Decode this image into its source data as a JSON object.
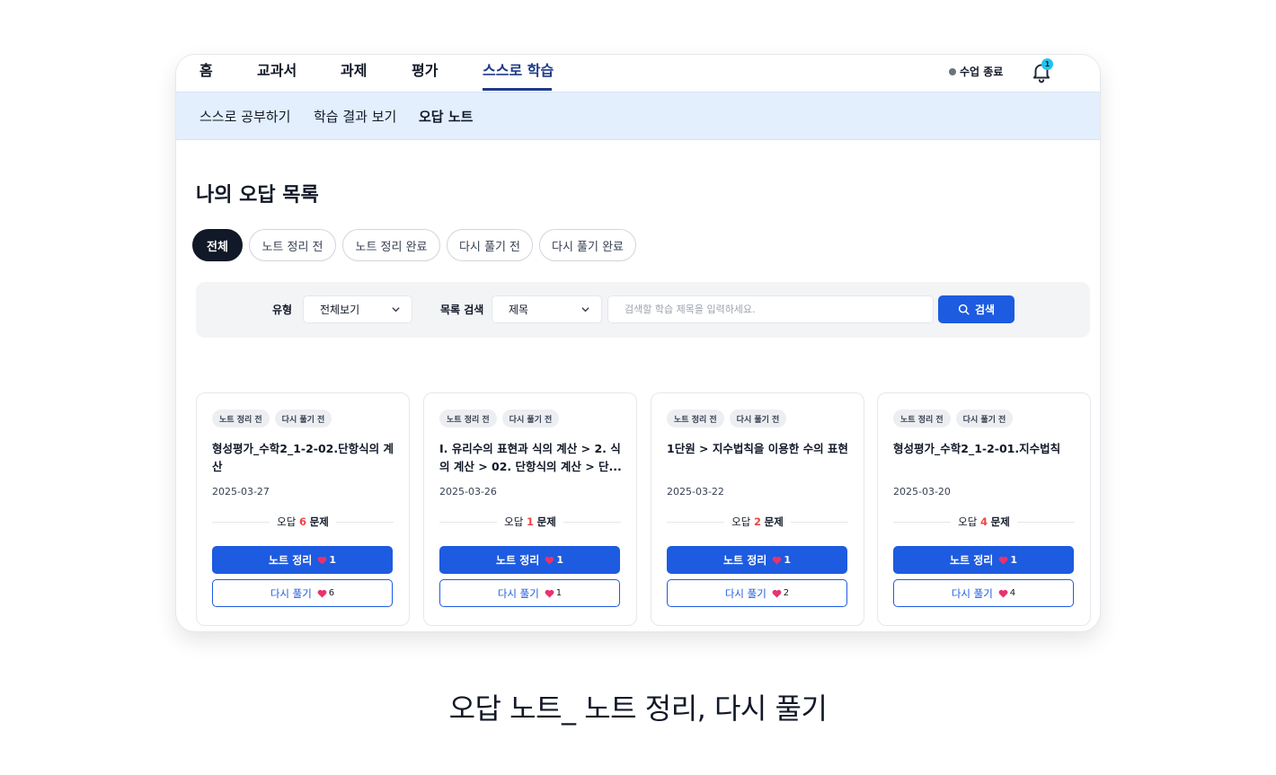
{
  "topnav": {
    "items": [
      "홈",
      "교과서",
      "과제",
      "평가",
      "스스로 학습"
    ],
    "active_index": 4,
    "class_status": "수업 종료",
    "notification_count": "1"
  },
  "subnav": {
    "items": [
      "스스로 공부하기",
      "학습 결과 보기",
      "오답 노트"
    ],
    "active_index": 2
  },
  "page_title": "나의 오답 목록",
  "filters": {
    "items": [
      "전체",
      "노트 정리 전",
      "노트 정리 완료",
      "다시 풀기 전",
      "다시 풀기 완료"
    ],
    "active_index": 0
  },
  "search": {
    "type_label": "유형",
    "type_value": "전체보기",
    "scope_label": "목록 검색",
    "scope_value": "제목",
    "placeholder": "검색할 학습 제목을 입력하세요.",
    "button_label": "검색"
  },
  "cards": [
    {
      "tags": [
        "노트 정리 전",
        "다시 풀기 전"
      ],
      "title": "형성평가_수학2_1-2-02.단항식의 계산",
      "date": "2025-03-27",
      "wrong_prefix": "오답",
      "wrong_count": "6",
      "wrong_unit": "문제",
      "note_label": "노트 정리",
      "note_likes": "1",
      "retry_label": "다시 풀기",
      "retry_likes": "6"
    },
    {
      "tags": [
        "노트 정리 전",
        "다시 풀기 전"
      ],
      "title": "I. 유리수의 표현과 식의 계산 > 2. 식의 계산 > 02. 단항식의 계산 > 단...",
      "date": "2025-03-26",
      "wrong_prefix": "오답",
      "wrong_count": "1",
      "wrong_unit": "문제",
      "note_label": "노트 정리",
      "note_likes": "1",
      "retry_label": "다시 풀기",
      "retry_likes": "1"
    },
    {
      "tags": [
        "노트 정리 전",
        "다시 풀기 전"
      ],
      "title": "1단원 > 지수법칙을 이용한 수의 표현",
      "date": "2025-03-22",
      "wrong_prefix": "오답",
      "wrong_count": "2",
      "wrong_unit": "문제",
      "note_label": "노트 정리",
      "note_likes": "1",
      "retry_label": "다시 풀기",
      "retry_likes": "2"
    },
    {
      "tags": [
        "노트 정리 전",
        "다시 풀기 전"
      ],
      "title": "형성평가_수학2_1-2-01.지수법칙",
      "date": "2025-03-20",
      "wrong_prefix": "오답",
      "wrong_count": "4",
      "wrong_unit": "문제",
      "note_label": "노트 정리",
      "note_likes": "1",
      "retry_label": "다시 풀기",
      "retry_likes": "4"
    }
  ],
  "caption": "오답 노트_ 노트 정리, 다시 풀기",
  "icons": {
    "bell": "bell-icon",
    "search": "search-icon",
    "chevron": "chevron-down-icon",
    "heart": "heart-icon",
    "status_dot": "status-dot-icon"
  },
  "colors": {
    "primary": "#1d5be0",
    "nav_active": "#1e3a8a",
    "subnav_bg": "#e3effd",
    "accent_red": "#ef4444",
    "heart": "#e8336d",
    "badge": "#22c3ee"
  }
}
